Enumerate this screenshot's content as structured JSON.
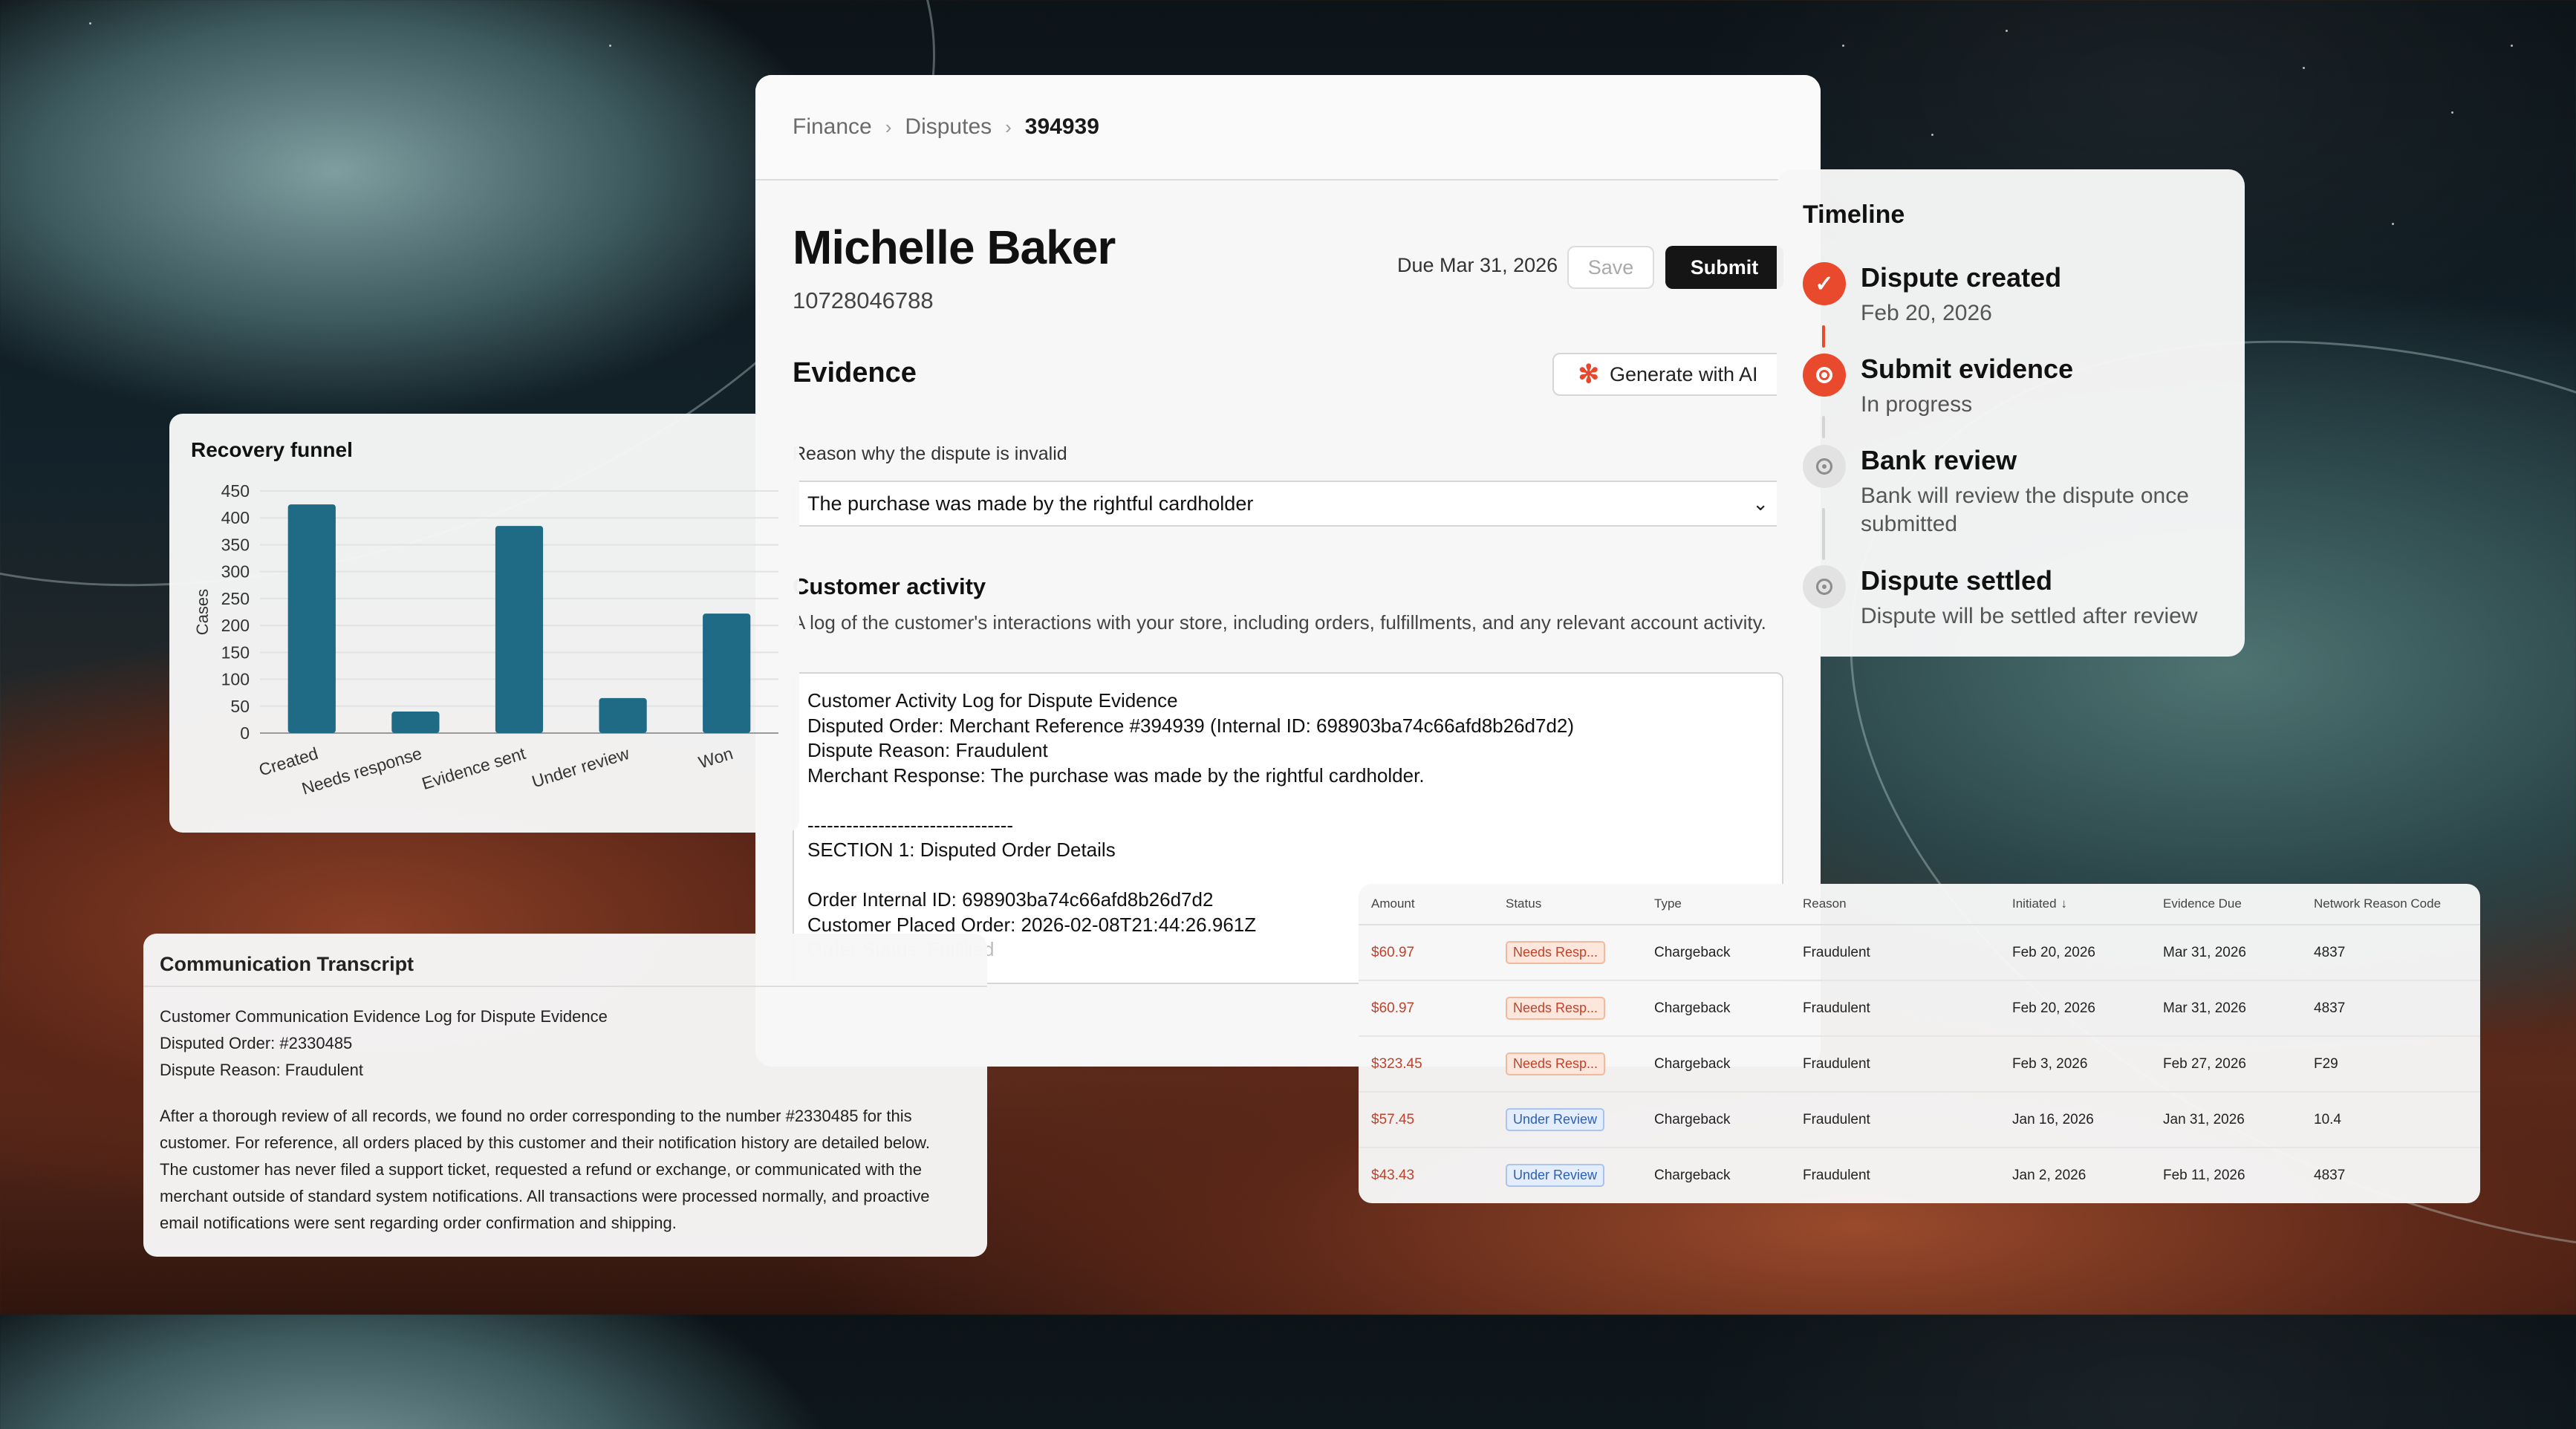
{
  "breadcrumb": [
    "Finance",
    "Disputes",
    "394939"
  ],
  "case": {
    "name": "Michelle Baker",
    "id": "10728046788",
    "due": "Due Mar 31, 2026",
    "save_label": "Save",
    "submit_label": "Submit"
  },
  "evidence": {
    "heading": "Evidence",
    "ai_button": "Generate with AI",
    "ai_icon": "sparkle-icon",
    "reason_label": "Reason why the dispute is invalid",
    "reason_value": "The purchase was made by the rightful cardholder"
  },
  "activity": {
    "heading": "Customer activity",
    "description": "A log of the customer's interactions with your store, including orders, fulfillments, and any relevant account activity.",
    "lines": [
      "Customer Activity Log for Dispute Evidence",
      "Disputed Order: Merchant Reference #394939 (Internal ID: 698903ba74c66afd8b26d7d2)",
      "Dispute Reason: Fraudulent",
      "Merchant Response: The purchase was made by the rightful cardholder.",
      "",
      "--------------------------------",
      "SECTION 1: Disputed Order Details",
      "",
      "Order Internal ID: 698903ba74c66afd8b26d7d2",
      "Customer Placed Order: 2026-02-08T21:44:26.961Z",
      "Order Status: Fulfilled"
    ]
  },
  "timeline": {
    "title": "Timeline",
    "steps": [
      {
        "title": "Dispute created",
        "sub": "Feb 20, 2026",
        "state": "done",
        "icon": "check-icon"
      },
      {
        "title": "Submit evidence",
        "sub": "In progress",
        "state": "active",
        "icon": "in-progress-icon"
      },
      {
        "title": "Bank review",
        "sub": "Bank will review the dispute once submitted",
        "state": "pending",
        "icon": "pending-icon"
      },
      {
        "title": "Dispute settled",
        "sub": "Dispute will be settled after review",
        "state": "pending",
        "icon": "pending-icon"
      }
    ],
    "colors": {
      "done": "#e9492c",
      "pending": "#d4d4d4"
    }
  },
  "chart_data": {
    "type": "bar",
    "title": "Recovery funnel",
    "ylabel": "Cases",
    "xlabel": "",
    "categories": [
      "Created",
      "Needs response",
      "Evidence sent",
      "Under review",
      "Won"
    ],
    "values": [
      425,
      40,
      385,
      65,
      222
    ],
    "ylim": [
      0,
      450
    ],
    "yticks": [
      0,
      50,
      100,
      150,
      200,
      250,
      300,
      350,
      400,
      450
    ],
    "grid": true,
    "color": "#1f6a85"
  },
  "transcript": {
    "title": "Communication Transcript",
    "lines": [
      "Customer Communication Evidence Log for Dispute Evidence",
      "Disputed Order: #2330485",
      "Dispute Reason: Fraudulent",
      "",
      "After a thorough review of all records, we found no order corresponding to the number #2330485 for this",
      "customer. For reference, all orders placed by this customer and their notification history are detailed below.",
      "The customer has never filed a support ticket, requested a refund or exchange, or communicated with the",
      "merchant outside of standard system notifications. All transactions were processed normally, and proactive",
      "email notifications were sent regarding order confirmation and shipping."
    ]
  },
  "disputes_table": {
    "columns": [
      "Amount",
      "Status",
      "Type",
      "Reason",
      "Initiated",
      "Evidence Due",
      "Network Reason Code"
    ],
    "sort_icon": "arrow-down-icon",
    "rows": [
      {
        "amount": "$60.97",
        "status": "Needs Resp...",
        "status_kind": "needs",
        "type": "Chargeback",
        "reason": "Fraudulent",
        "initiated": "Feb 20, 2026",
        "due": "Mar 31, 2026",
        "code": "4837"
      },
      {
        "amount": "$60.97",
        "status": "Needs Resp...",
        "status_kind": "needs",
        "type": "Chargeback",
        "reason": "Fraudulent",
        "initiated": "Feb 20, 2026",
        "due": "Mar 31, 2026",
        "code": "4837"
      },
      {
        "amount": "$323.45",
        "status": "Needs Resp...",
        "status_kind": "needs",
        "type": "Chargeback",
        "reason": "Fraudulent",
        "initiated": "Feb 3, 2026",
        "due": "Feb 27, 2026",
        "code": "F29"
      },
      {
        "amount": "$57.45",
        "status": "Under Review",
        "status_kind": "review",
        "type": "Chargeback",
        "reason": "Fraudulent",
        "initiated": "Jan 16, 2026",
        "due": "Jan 31, 2026",
        "code": "10.4"
      },
      {
        "amount": "$43.43",
        "status": "Under Review",
        "status_kind": "review",
        "type": "Chargeback",
        "reason": "Fraudulent",
        "initiated": "Jan 2, 2026",
        "due": "Feb 11, 2026",
        "code": "4837"
      }
    ]
  }
}
